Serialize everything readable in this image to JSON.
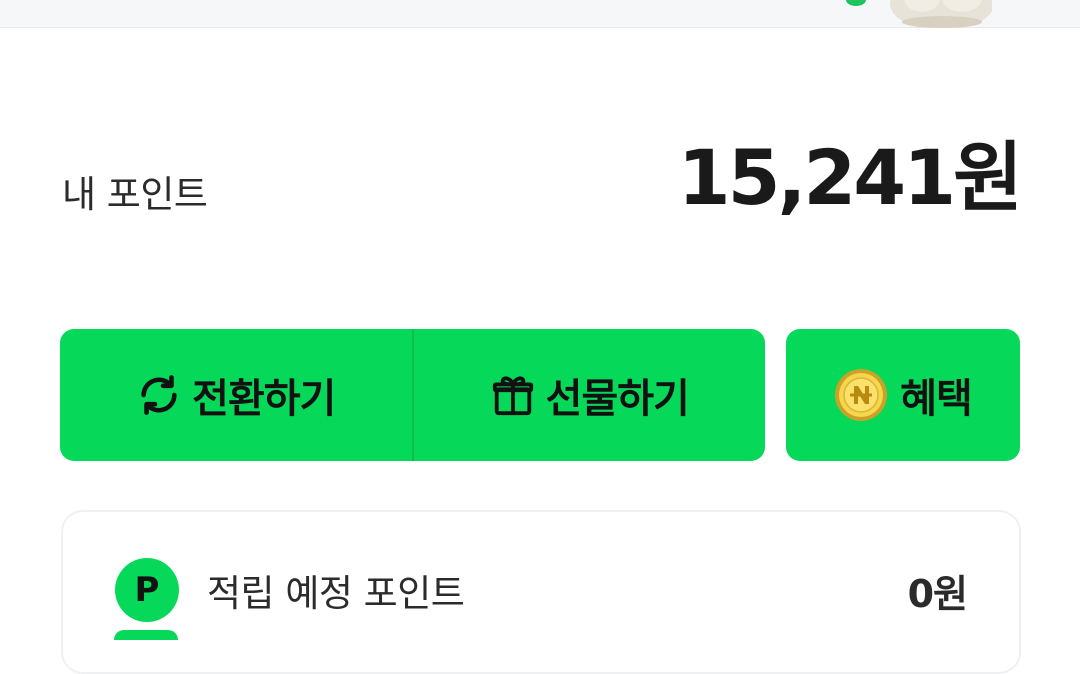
{
  "header": {
    "mascot_icon": "rabbit-mascot-icon"
  },
  "summary": {
    "label": "내 포인트",
    "amount": "15,241원"
  },
  "actions": {
    "convert": {
      "label": "전환하기",
      "icon": "refresh-icon"
    },
    "gift": {
      "label": "선물하기",
      "icon": "gift-icon"
    },
    "benefit": {
      "label": "혜택",
      "icon": "n-coin-icon"
    }
  },
  "card": {
    "rows": [
      {
        "badge": "P",
        "label": "적립 예정 포인트",
        "value": "0원"
      }
    ]
  },
  "colors": {
    "accent": "#06d85a",
    "text": "#1a1a1a",
    "banner_bg": "#f6f7f9"
  }
}
